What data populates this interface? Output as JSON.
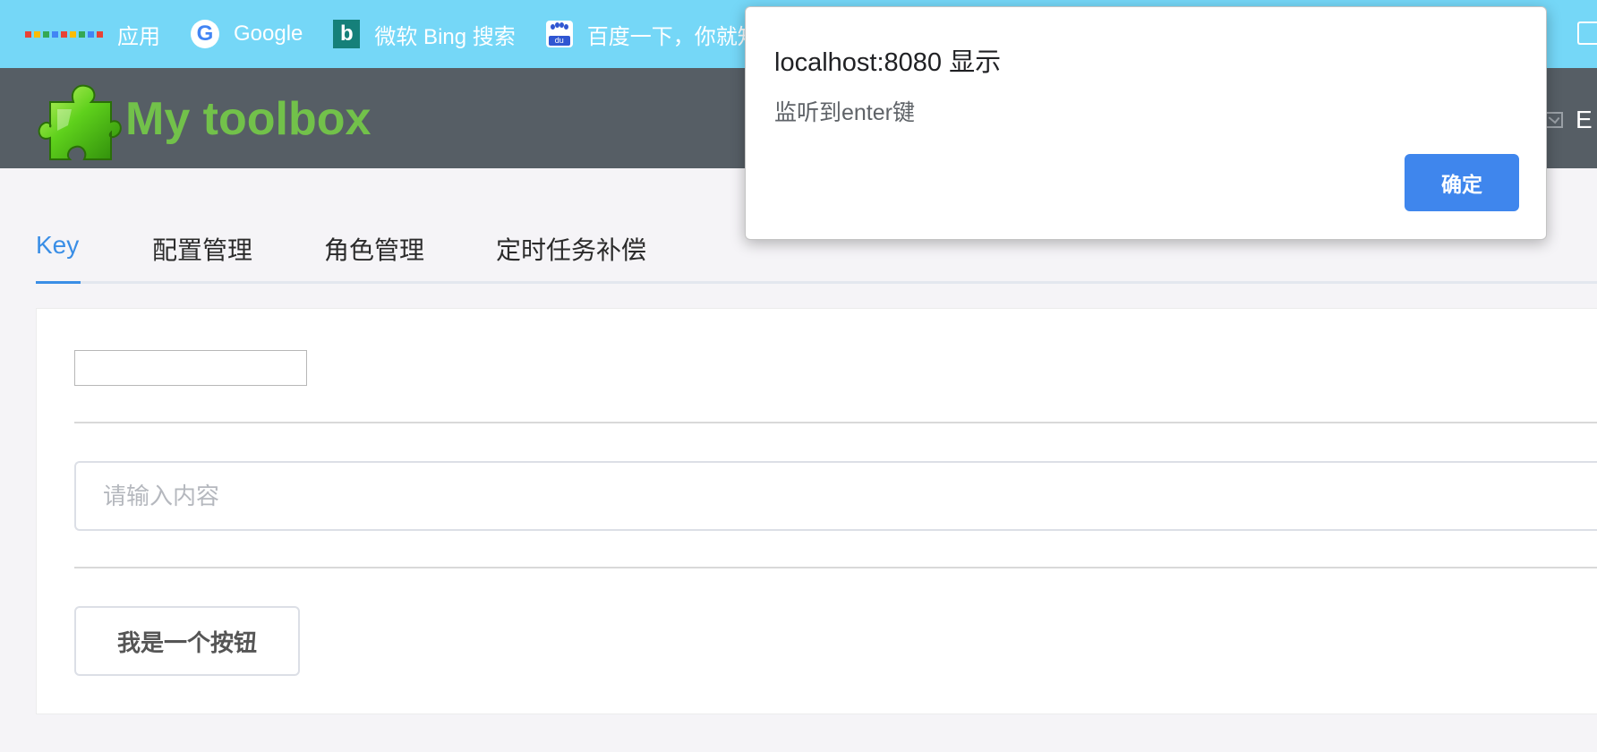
{
  "bookmarks": {
    "items": [
      {
        "label": "应用",
        "icon": "apps-grid-icon"
      },
      {
        "label": "Google",
        "icon": "google-icon"
      },
      {
        "label": "微软 Bing 搜索",
        "icon": "bing-icon"
      },
      {
        "label": "百度一下，你就知道",
        "icon": "baidu-icon"
      }
    ],
    "google_glyph": "G",
    "bing_glyph": "b",
    "baidu_glyph": "du",
    "apps_colors": [
      "#e94235",
      "#fbbc04",
      "#34a853",
      "#4285f4",
      "#e94235",
      "#fbbc04",
      "#34a853",
      "#4285f4",
      "#e94235"
    ]
  },
  "header": {
    "logo_text": "My toolbox",
    "right_text": "E",
    "logo_color": "#72c14a",
    "background": "#565e65"
  },
  "tabs": [
    {
      "label": "Key",
      "active": true
    },
    {
      "label": "配置管理",
      "active": false
    },
    {
      "label": "角色管理",
      "active": false
    },
    {
      "label": "定时任务补偿",
      "active": false
    }
  ],
  "form": {
    "small_input_value": "",
    "content_input_placeholder": "请输入内容",
    "button_label": "我是一个按钮"
  },
  "dialog": {
    "title": "localhost:8080 显示",
    "message": "监听到enter键",
    "ok_label": "确定",
    "accent": "#3f86ed"
  }
}
